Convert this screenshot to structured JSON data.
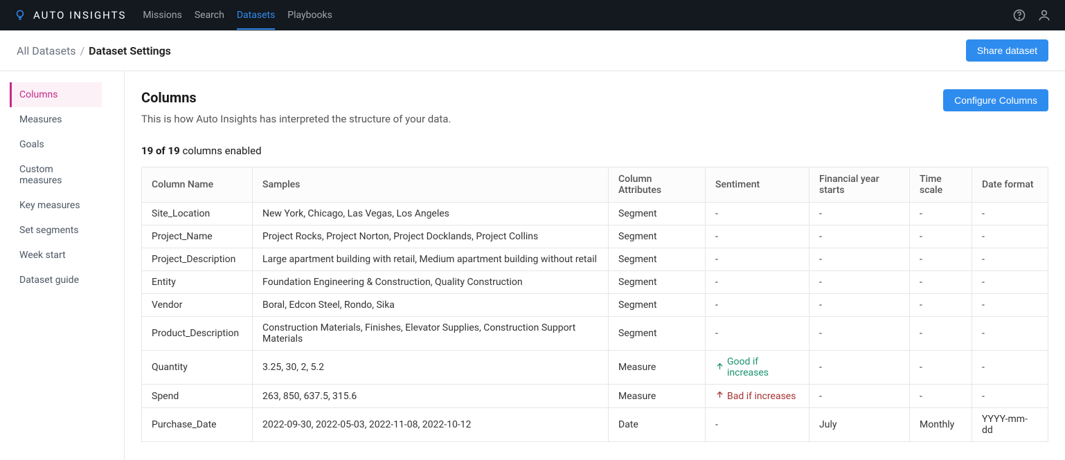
{
  "brand": "AUTO INSIGHTS",
  "nav": {
    "missions": "Missions",
    "search": "Search",
    "datasets": "Datasets",
    "playbooks": "Playbooks"
  },
  "breadcrumb": {
    "all": "All Datasets",
    "sep": "/",
    "current": "Dataset Settings"
  },
  "share_btn": "Share dataset",
  "sidebar": {
    "columns": "Columns",
    "measures": "Measures",
    "goals": "Goals",
    "custom_measures": "Custom measures",
    "key_measures": "Key measures",
    "set_segments": "Set segments",
    "week_start": "Week start",
    "dataset_guide": "Dataset guide"
  },
  "page": {
    "title": "Columns",
    "subtitle": "This is how Auto Insights has interpreted the structure of your data.",
    "configure_btn": "Configure Columns",
    "count_bold": "19 of 19",
    "count_rest": " columns enabled"
  },
  "table": {
    "headers": {
      "name": "Column Name",
      "samples": "Samples",
      "attributes": "Column Attributes",
      "sentiment": "Sentiment",
      "fin_year": "Financial year starts",
      "time_scale": "Time scale",
      "date_format": "Date format"
    },
    "rows": [
      {
        "name": "Site_Location",
        "samples": "New York, Chicago, Las Vegas, Los Angeles",
        "attr": "Segment",
        "sent": "-",
        "fin": "-",
        "ts": "-",
        "df": "-"
      },
      {
        "name": "Project_Name",
        "samples": "Project Rocks, Project Norton, Project Docklands, Project Collins",
        "attr": "Segment",
        "sent": "-",
        "fin": "-",
        "ts": "-",
        "df": "-"
      },
      {
        "name": "Project_Description",
        "samples": "Large apartment building with retail, Medium apartment building without retail",
        "attr": "Segment",
        "sent": "-",
        "fin": "-",
        "ts": "-",
        "df": "-"
      },
      {
        "name": "Entity",
        "samples": "Foundation Engineering & Construction, Quality Construction",
        "attr": "Segment",
        "sent": "-",
        "fin": "-",
        "ts": "-",
        "df": "-"
      },
      {
        "name": "Vendor",
        "samples": "Boral, Edcon Steel, Rondo, Sika",
        "attr": "Segment",
        "sent": "-",
        "fin": "-",
        "ts": "-",
        "df": "-"
      },
      {
        "name": "Product_Description",
        "samples": "Construction Materials, Finishes, Elevator Supplies, Construction Support Materials",
        "attr": "Segment",
        "sent": "-",
        "fin": "-",
        "ts": "-",
        "df": "-"
      },
      {
        "name": "Quantity",
        "samples": "3.25, 30, 2, 5.2",
        "attr": "Measure",
        "sent": "Good if increases",
        "sent_type": "good",
        "fin": "-",
        "ts": "-",
        "df": "-"
      },
      {
        "name": "Spend",
        "samples": "263, 850, 637.5, 315.6",
        "attr": "Measure",
        "sent": "Bad if increases",
        "sent_type": "bad",
        "fin": "-",
        "ts": "-",
        "df": "-"
      },
      {
        "name": "Purchase_Date",
        "samples": "2022-09-30, 2022-05-03, 2022-11-08, 2022-10-12",
        "attr": "Date",
        "sent": "-",
        "fin": "July",
        "ts": "Monthly",
        "df": "YYYY-mm-dd"
      }
    ]
  }
}
